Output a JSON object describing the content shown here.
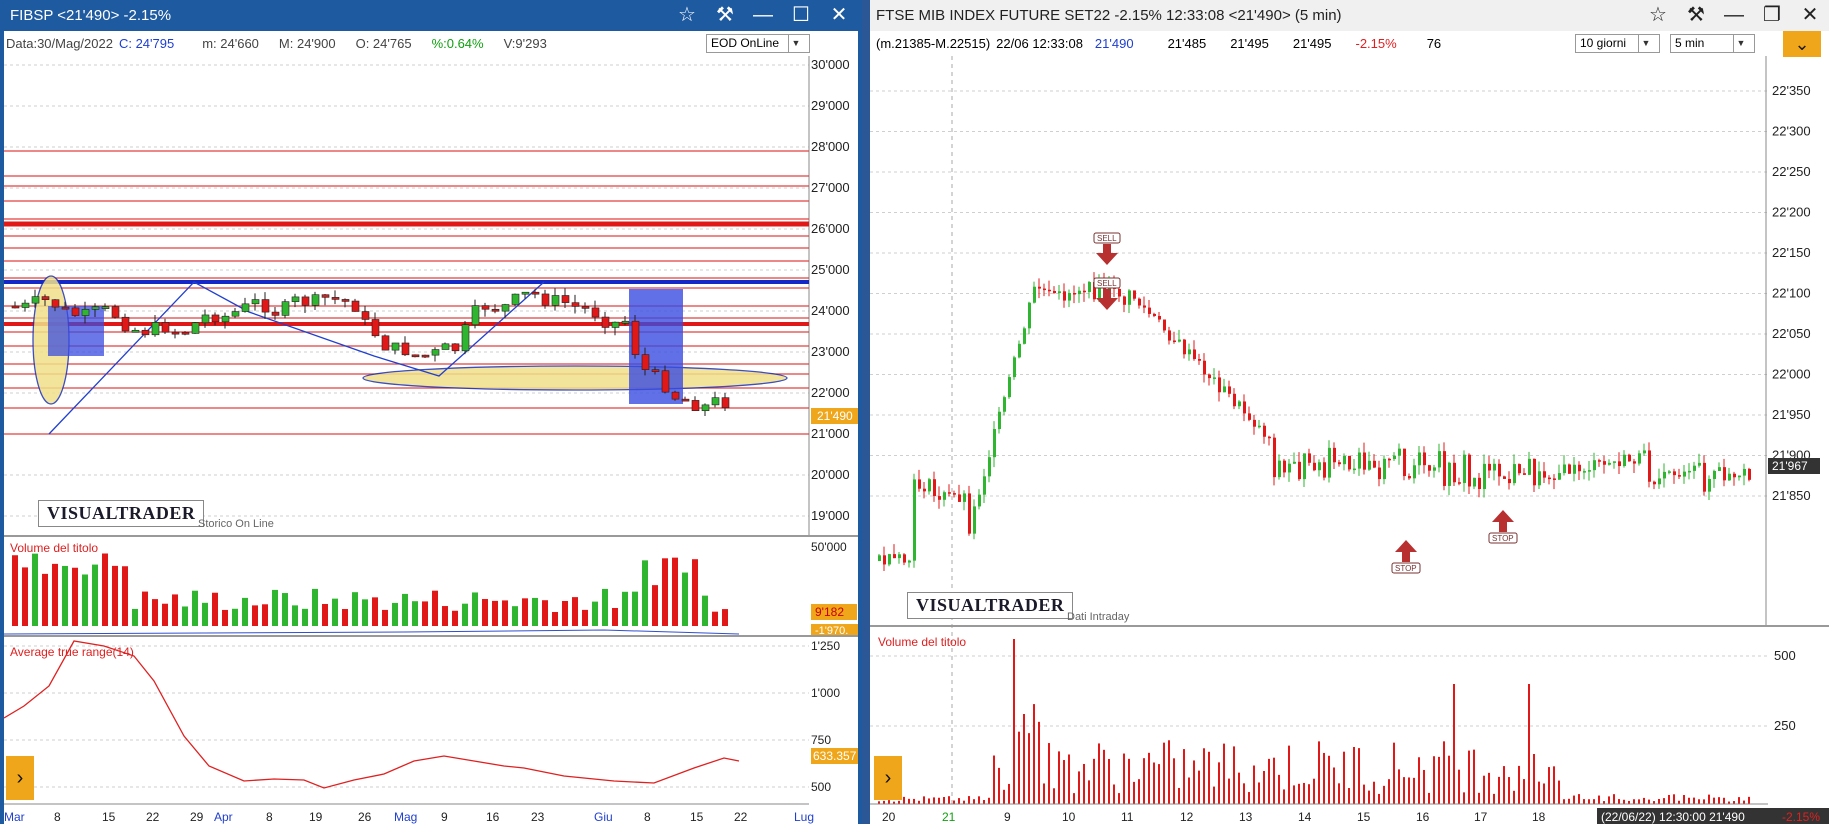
{
  "left": {
    "title": "FIBSP <21'490> -2.15%",
    "info": {
      "date": "Data:30/Mag/2022",
      "close": "C: 24'795",
      "min": "m: 24'660",
      "max": "M: 24'900",
      "open": "O: 24'765",
      "pct": "%:0.64%",
      "vol": "V:9'293"
    },
    "feed_select": "EOD OnLine",
    "price_axis": [
      "30'000",
      "29'000",
      "28'000",
      "27'000",
      "26'000",
      "25'000",
      "24'000",
      "23'000",
      "22'000",
      "21'000",
      "20'000",
      "19'000"
    ],
    "last_price": "21'490",
    "logo": "VISUALTRADER",
    "logo_sub": "Storico On Line",
    "volume_title": "Volume del titolo",
    "volume_axis": [
      "50'000"
    ],
    "volume_last": "9'182",
    "volume_ma_last": "-1'970.",
    "atr_title": "Average true range(14)",
    "atr_axis": [
      "1'250",
      "1'000",
      "750",
      "500"
    ],
    "atr_last": "633.357",
    "date_axis": [
      "Mar",
      "8",
      "15",
      "22",
      "29",
      "Apr",
      "8",
      "19",
      "26",
      "Mag",
      "9",
      "16",
      "23",
      "Giu",
      "8",
      "15",
      "22",
      "Lug"
    ]
  },
  "right": {
    "title": "FTSE MIB INDEX FUTURE SET22 -2.15% 12:33:08  <21'490> (5 min)",
    "info": {
      "range": "(m.21385-M.22515)",
      "datetime": "22/06 12:33:08",
      "last": "21'490",
      "v1": "21'485",
      "v2": "21'495",
      "v3": "21'495",
      "pct": "-2.15%",
      "count": "76"
    },
    "period_select": "10 giorni",
    "interval_select": "5 min",
    "price_axis": [
      "22'350",
      "22'300",
      "22'250",
      "22'200",
      "22'150",
      "22'100",
      "22'050",
      "22'000",
      "21'950",
      "21'900",
      "21'850"
    ],
    "last_price": "21'967",
    "sell_label": "SELL",
    "stop_label": "STOP",
    "logo": "VISUALTRADER",
    "logo_sub": "Dati Intraday",
    "volume_title": "Volume del titolo",
    "volume_axis": [
      "500",
      "250"
    ],
    "date_axis": [
      "20",
      "21",
      "9",
      "10",
      "11",
      "12",
      "13",
      "14",
      "15",
      "16",
      "17",
      "18"
    ],
    "status": "(22/06/22) 12:30:00 21'490",
    "status_pct": "-2.15%"
  },
  "colors": {
    "up": "#2fb52f",
    "down": "#e01818",
    "accent": "#f0a61a",
    "titlebar": "#1e5aa0"
  }
}
